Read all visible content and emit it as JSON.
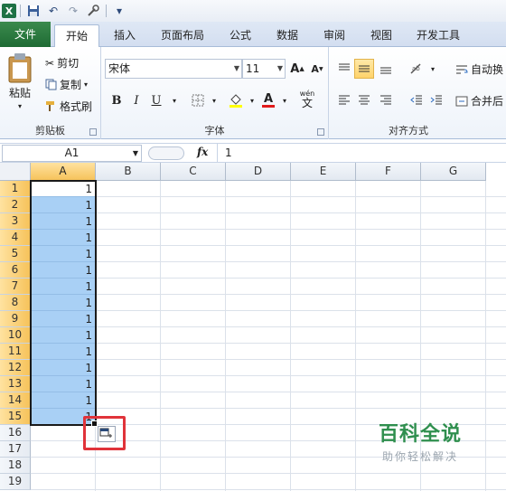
{
  "quick_access": {
    "save": "💾",
    "undo": "↶",
    "redo": "↷",
    "customize": "▾"
  },
  "tabs": [
    "文件",
    "开始",
    "插入",
    "页面布局",
    "公式",
    "数据",
    "审阅",
    "视图",
    "开发工具"
  ],
  "ribbon": {
    "clipboard": {
      "paste": "粘贴",
      "cut": "剪切",
      "copy": "复制",
      "format_painter": "格式刷",
      "label": "剪贴板"
    },
    "font": {
      "name": "宋体",
      "size": "11",
      "grow": "A",
      "shrink": "A",
      "bold": "B",
      "italic": "I",
      "underline": "U",
      "font_color_letter": "A",
      "wen": "wén",
      "wen_char": "文",
      "label": "字体"
    },
    "alignment": {
      "wrap": "自动换",
      "merge": "合并后",
      "label": "对齐方式"
    }
  },
  "formula_bar": {
    "name_box": "A1",
    "fx": "fx",
    "value": "1"
  },
  "columns": [
    "A",
    "B",
    "C",
    "D",
    "E",
    "F",
    "G"
  ],
  "rows": [
    "1",
    "2",
    "3",
    "4",
    "5",
    "6",
    "7",
    "8",
    "9",
    "10",
    "11",
    "12",
    "13",
    "14",
    "15",
    "16",
    "17",
    "18",
    "19"
  ],
  "cells_a": [
    "1",
    "1",
    "1",
    "1",
    "1",
    "1",
    "1",
    "1",
    "1",
    "1",
    "1",
    "1",
    "1",
    "1",
    "1"
  ],
  "watermark": {
    "title": "百科全说",
    "subtitle": "助你轻松解决"
  },
  "colors": {
    "file_tab": "#1f6b34",
    "selection": "#a9d0f5",
    "highlight_box": "#e0333a",
    "active_header": "#f6c35b"
  }
}
